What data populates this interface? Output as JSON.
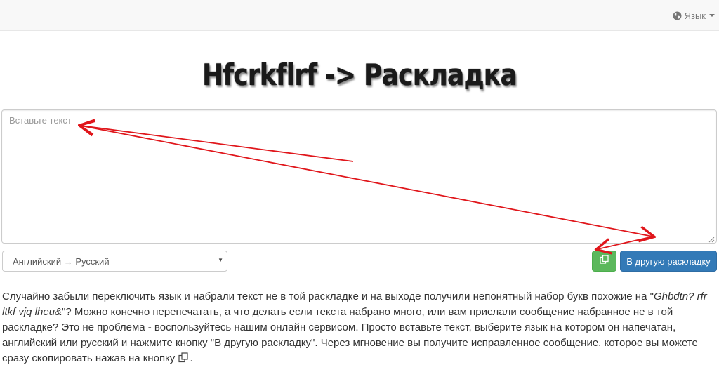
{
  "navbar": {
    "language_label": "Язык",
    "language_icon": "globe-icon"
  },
  "page": {
    "title": "Hfcrkflrf -> Раскладка"
  },
  "input": {
    "placeholder": "Вставьте текст",
    "value": ""
  },
  "controls": {
    "direction_selected": "Английский → Русский",
    "copy_icon": "copy-icon",
    "switch_button_label": "В другую раскладку"
  },
  "description": {
    "part1": "Случайно забыли переключить язык и набрали текст не в той раскладке и на выходе получили непонятный набор букв похожие на \"",
    "example": "Ghbdtn? rfr ltkf vjq lheu&",
    "part2": "\"? Можно конечно перепечатать, а что делать если текста набрано много, или вам прислали сообщение набранное не в той раскладке? Это не проблема - воспользуйтесь нашим онлайн сервисом. Просто вставьте текст, выберите язык на котором он напечатан, английский или русский и нажмите кнопку \"В другую раскладку\". Через мгновение вы получите исправленное сообщение, которое вы можете сразу скопировать нажав на кнопку",
    "part3": "."
  },
  "colors": {
    "copy_button": "#5cb85c",
    "switch_button": "#337ab7",
    "annotation_arrows": "#e0161b"
  }
}
